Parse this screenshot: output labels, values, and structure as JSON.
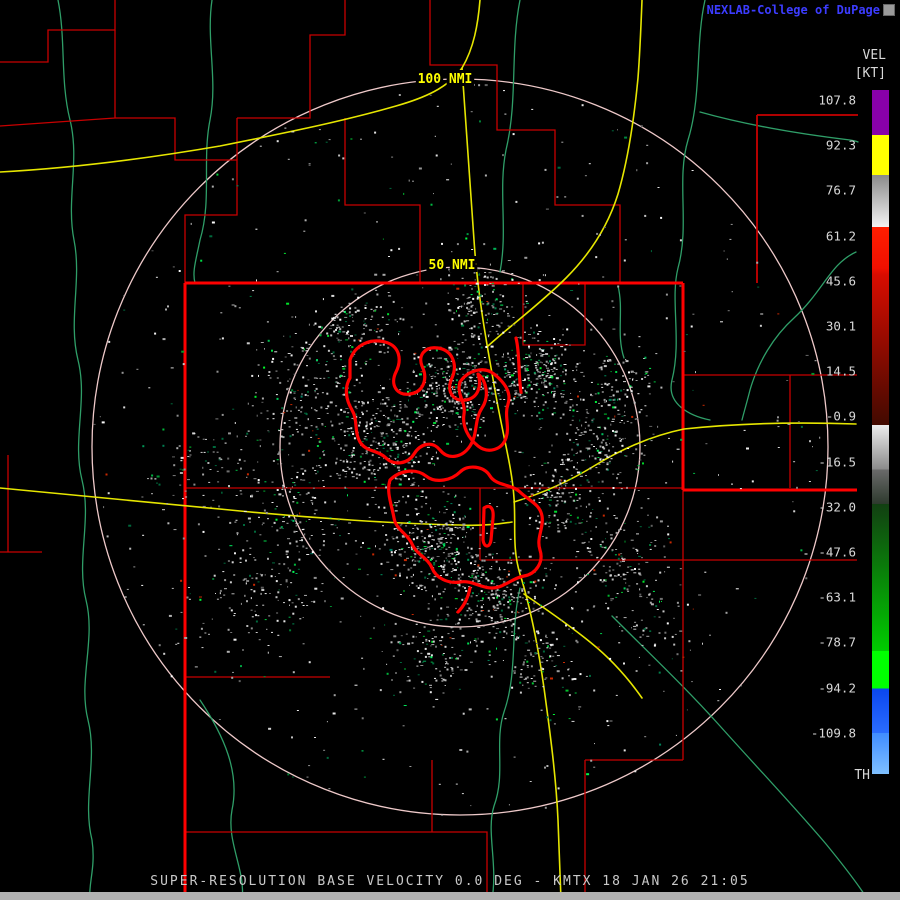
{
  "branding": {
    "text": "NEXLAB-College of DuPage"
  },
  "icons": {
    "brand_badge": "gray-box-glyph"
  },
  "colorbar": {
    "title": "VEL",
    "units": "[KT]",
    "bottom_label": "TH",
    "ticks": [
      "107.8",
      "92.3",
      "76.7",
      "61.2",
      "45.6",
      "30.1",
      "14.5",
      "-0.9",
      "-16.5",
      "-32.0",
      "-47.6",
      "-63.1",
      "-78.7",
      "-94.2",
      "-109.8"
    ]
  },
  "map": {
    "range_ring_labels": {
      "outer": "100 NMI",
      "inner": "50 NMI"
    }
  },
  "product": {
    "name": "SUPER-RESOLUTION BASE VELOCITY",
    "elevation": "0.0 DEG",
    "station": "KMTX",
    "datetime": "18 JAN 26 21:05"
  },
  "status_bar": {
    "text": "SUPER-RESOLUTION BASE VELOCITY 0.0 DEG - KMTX 18 JAN 26 21:05"
  },
  "colors": {
    "county": "#c80000",
    "state": "#ff0000",
    "urban": "#ff0000",
    "highway": "#e6e600",
    "river": "#2f9e68",
    "ring": "#eec9c9",
    "ring-label": "#ffff00",
    "brand": "#3c3cff",
    "label": "#d8d8d8"
  }
}
